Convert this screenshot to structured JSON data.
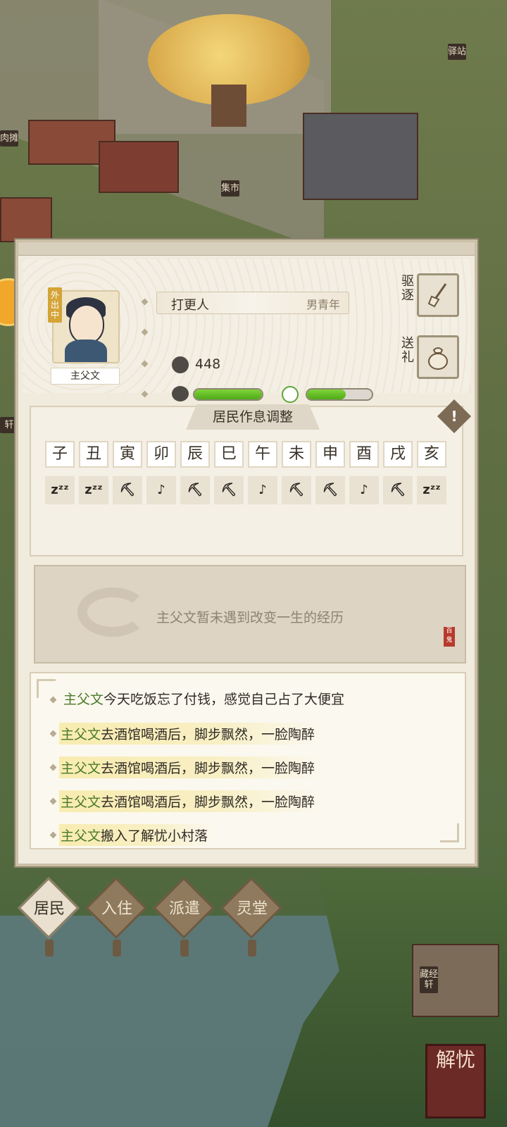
{
  "map_signs": {
    "meat_stall": "肉摊",
    "market": "集市",
    "post_station": "驿站",
    "xuan": "轩",
    "library": "藏经轩"
  },
  "resident": {
    "status_tag": "外出中",
    "name": "主父文",
    "occupation": "打更人",
    "gender_age": "男青年",
    "money": "448",
    "health_fraction": 1.0,
    "mood_fraction": 0.6
  },
  "actions": {
    "expel_label": "驱逐",
    "gift_label": "送礼"
  },
  "schedule": {
    "title": "居民作息调整",
    "hours": [
      "子",
      "丑",
      "寅",
      "卯",
      "辰",
      "巳",
      "午",
      "未",
      "申",
      "酉",
      "戌",
      "亥"
    ],
    "activities": [
      "sleep",
      "sleep",
      "work",
      "rest",
      "work",
      "work",
      "rest",
      "work",
      "work",
      "rest",
      "work",
      "sleep"
    ],
    "activity_glyphs": {
      "sleep": "zᶻᶻ",
      "work": "⛏",
      "rest": "♪"
    }
  },
  "experience": {
    "text": "主父文暂未遇到改变一生的经历",
    "seal_text": "百鬼"
  },
  "log": [
    {
      "who": "主父文",
      "text": "今天吃饭忘了付钱，感觉自己占了大便宜",
      "highlight": false
    },
    {
      "who": "主父文",
      "text": "去酒馆喝酒后，脚步飘然，一脸陶醉",
      "highlight": true
    },
    {
      "who": "主父文",
      "text": "去酒馆喝酒后，脚步飘然，一脸陶醉",
      "highlight": true
    },
    {
      "who": "主父文",
      "text": "去酒馆喝酒后，脚步飘然，一脸陶醉",
      "highlight": true
    },
    {
      "who": "主父文",
      "text": "搬入了解忧小村落",
      "highlight": true
    }
  ],
  "tabs": [
    {
      "label": "居民",
      "active": true
    },
    {
      "label": "入住",
      "active": false
    },
    {
      "label": "派遣",
      "active": false
    },
    {
      "label": "灵堂",
      "active": false
    }
  ],
  "corner_button": "解忧",
  "colors": {
    "accent_green": "#4eaa18",
    "name_green": "#4b7a2a",
    "panel_bg": "#f1ebde",
    "seal_red": "#b73a2c"
  }
}
